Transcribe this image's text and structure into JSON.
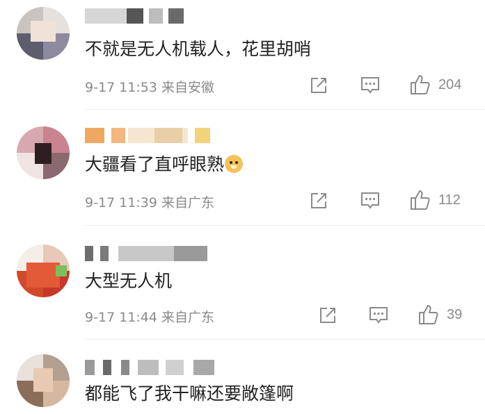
{
  "comments": [
    {
      "text": "不就是无人机载人，花里胡哨",
      "date": "9-17 11:53",
      "location": "来自安徽",
      "likes": "204"
    },
    {
      "text": "大疆看了直呼眼熟",
      "emoji": "doge-emoji",
      "date": "9-17 11:39",
      "location": "来自广东",
      "likes": "112"
    },
    {
      "text": "大型无人机",
      "date": "9-17 11:44",
      "location": "来自广东",
      "likes": "39"
    },
    {
      "text": "都能飞了我干嘛还要敞篷啊"
    }
  ],
  "icons": {
    "share": "share-icon",
    "reply": "comment-icon",
    "like": "thumbs-up-icon"
  },
  "colors": {
    "text": "#222222",
    "meta": "#8a8a8a",
    "divider": "#ededed"
  }
}
